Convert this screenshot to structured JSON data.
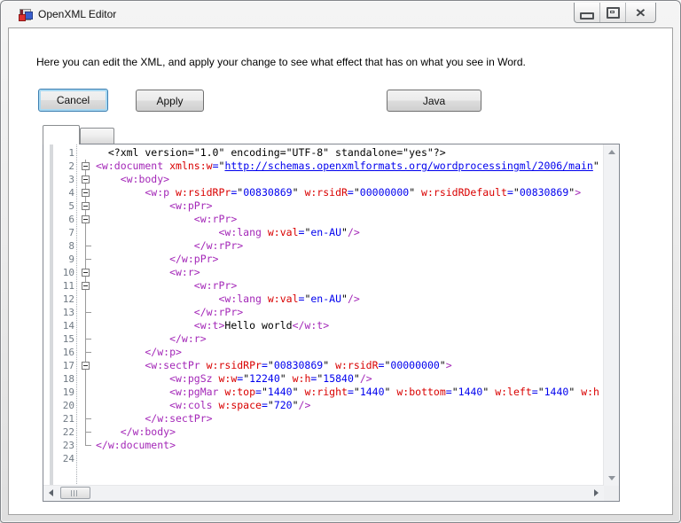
{
  "window": {
    "title": "OpenXML Editor",
    "controls": {
      "minimize_icon": "minimize",
      "maximize_icon": "maximize",
      "close_icon": "✕"
    }
  },
  "instructions": "Here you can edit the XML, and apply your change to see what effect that has on what you see in Word.",
  "buttons": {
    "cancel": "Cancel",
    "apply": "Apply",
    "java": "Java"
  },
  "tabs": [
    {
      "label": ""
    },
    {
      "label": ""
    }
  ],
  "colors": {
    "syntax": {
      "tag": "#A428B8",
      "attr": "#D90000",
      "value": "#0000EE",
      "equals": "#0000EE",
      "quote": "#000000",
      "text": "#000000",
      "link": "#0000EE"
    },
    "focus_accent": "#3C7FB1",
    "line_number": "#707A84"
  },
  "editor": {
    "lines": [
      {
        "num": 1,
        "fold": "none",
        "tokens": [
          [
            "x",
            "  <?xml version=\"1.0\" encoding=\"UTF-8\" standalone=\"yes\"?>"
          ]
        ]
      },
      {
        "num": 2,
        "fold": "box",
        "tokens": [
          [
            "t",
            "<w:document "
          ],
          [
            "a",
            "xmlns:w"
          ],
          [
            "e",
            "="
          ],
          [
            "q",
            "\""
          ],
          [
            "u",
            "http://schemas.openxmlformats.org/wordprocessingml/2006/main"
          ],
          [
            "q",
            "\""
          ]
        ]
      },
      {
        "num": 3,
        "fold": "box",
        "tokens": [
          [
            "t",
            "    <w:body>"
          ]
        ]
      },
      {
        "num": 4,
        "fold": "box",
        "tokens": [
          [
            "t",
            "        <w:p "
          ],
          [
            "a",
            "w:rsidRPr"
          ],
          [
            "e",
            "="
          ],
          [
            "q",
            "\""
          ],
          [
            "v",
            "00830869"
          ],
          [
            "q",
            "\" "
          ],
          [
            "a",
            "w:rsidR"
          ],
          [
            "e",
            "="
          ],
          [
            "q",
            "\""
          ],
          [
            "v",
            "00000000"
          ],
          [
            "q",
            "\" "
          ],
          [
            "a",
            "w:rsidRDefault"
          ],
          [
            "e",
            "="
          ],
          [
            "q",
            "\""
          ],
          [
            "v",
            "00830869"
          ],
          [
            "q",
            "\""
          ],
          [
            "t",
            ">"
          ]
        ]
      },
      {
        "num": 5,
        "fold": "box",
        "tokens": [
          [
            "t",
            "            <w:pPr>"
          ]
        ]
      },
      {
        "num": 6,
        "fold": "box",
        "tokens": [
          [
            "t",
            "                <w:rPr>"
          ]
        ]
      },
      {
        "num": 7,
        "fold": "line",
        "tokens": [
          [
            "t",
            "                    <w:lang "
          ],
          [
            "a",
            "w:val"
          ],
          [
            "e",
            "="
          ],
          [
            "q",
            "\""
          ],
          [
            "v",
            "en-AU"
          ],
          [
            "q",
            "\""
          ],
          [
            "t",
            "/>"
          ]
        ]
      },
      {
        "num": 8,
        "fold": "tick",
        "tokens": [
          [
            "t",
            "                </w:rPr>"
          ]
        ]
      },
      {
        "num": 9,
        "fold": "tick",
        "tokens": [
          [
            "t",
            "            </w:pPr>"
          ]
        ]
      },
      {
        "num": 10,
        "fold": "box",
        "tokens": [
          [
            "t",
            "            <w:r>"
          ]
        ]
      },
      {
        "num": 11,
        "fold": "box",
        "tokens": [
          [
            "t",
            "                <w:rPr>"
          ]
        ]
      },
      {
        "num": 12,
        "fold": "line",
        "tokens": [
          [
            "t",
            "                    <w:lang "
          ],
          [
            "a",
            "w:val"
          ],
          [
            "e",
            "="
          ],
          [
            "q",
            "\""
          ],
          [
            "v",
            "en-AU"
          ],
          [
            "q",
            "\""
          ],
          [
            "t",
            "/>"
          ]
        ]
      },
      {
        "num": 13,
        "fold": "tick",
        "tokens": [
          [
            "t",
            "                </w:rPr>"
          ]
        ]
      },
      {
        "num": 14,
        "fold": "line",
        "tokens": [
          [
            "t",
            "                <w:t>"
          ],
          [
            "x",
            "Hello world"
          ],
          [
            "t",
            "</w:t>"
          ]
        ]
      },
      {
        "num": 15,
        "fold": "tick",
        "tokens": [
          [
            "t",
            "            </w:r>"
          ]
        ]
      },
      {
        "num": 16,
        "fold": "tick",
        "tokens": [
          [
            "t",
            "        </w:p>"
          ]
        ]
      },
      {
        "num": 17,
        "fold": "box",
        "tokens": [
          [
            "t",
            "        <w:sectPr "
          ],
          [
            "a",
            "w:rsidRPr"
          ],
          [
            "e",
            "="
          ],
          [
            "q",
            "\""
          ],
          [
            "v",
            "00830869"
          ],
          [
            "q",
            "\" "
          ],
          [
            "a",
            "w:rsidR"
          ],
          [
            "e",
            "="
          ],
          [
            "q",
            "\""
          ],
          [
            "v",
            "00000000"
          ],
          [
            "q",
            "\""
          ],
          [
            "t",
            ">"
          ]
        ]
      },
      {
        "num": 18,
        "fold": "line",
        "tokens": [
          [
            "t",
            "            <w:pgSz "
          ],
          [
            "a",
            "w:w"
          ],
          [
            "e",
            "="
          ],
          [
            "q",
            "\""
          ],
          [
            "v",
            "12240"
          ],
          [
            "q",
            "\" "
          ],
          [
            "a",
            "w:h"
          ],
          [
            "e",
            "="
          ],
          [
            "q",
            "\""
          ],
          [
            "v",
            "15840"
          ],
          [
            "q",
            "\""
          ],
          [
            "t",
            "/>"
          ]
        ]
      },
      {
        "num": 19,
        "fold": "line",
        "tokens": [
          [
            "t",
            "            <w:pgMar "
          ],
          [
            "a",
            "w:top"
          ],
          [
            "e",
            "="
          ],
          [
            "q",
            "\""
          ],
          [
            "v",
            "1440"
          ],
          [
            "q",
            "\" "
          ],
          [
            "a",
            "w:right"
          ],
          [
            "e",
            "="
          ],
          [
            "q",
            "\""
          ],
          [
            "v",
            "1440"
          ],
          [
            "q",
            "\" "
          ],
          [
            "a",
            "w:bottom"
          ],
          [
            "e",
            "="
          ],
          [
            "q",
            "\""
          ],
          [
            "v",
            "1440"
          ],
          [
            "q",
            "\" "
          ],
          [
            "a",
            "w:left"
          ],
          [
            "e",
            "="
          ],
          [
            "q",
            "\""
          ],
          [
            "v",
            "1440"
          ],
          [
            "q",
            "\" "
          ],
          [
            "a",
            "w:h"
          ]
        ]
      },
      {
        "num": 20,
        "fold": "line",
        "tokens": [
          [
            "t",
            "            <w:cols "
          ],
          [
            "a",
            "w:space"
          ],
          [
            "e",
            "="
          ],
          [
            "q",
            "\""
          ],
          [
            "v",
            "720"
          ],
          [
            "q",
            "\""
          ],
          [
            "t",
            "/>"
          ]
        ]
      },
      {
        "num": 21,
        "fold": "tick",
        "tokens": [
          [
            "t",
            "        </w:sectPr>"
          ]
        ]
      },
      {
        "num": 22,
        "fold": "tick",
        "tokens": [
          [
            "t",
            "    </w:body>"
          ]
        ]
      },
      {
        "num": 23,
        "fold": "end",
        "tokens": [
          [
            "t",
            "</w:document>"
          ]
        ]
      },
      {
        "num": 24,
        "fold": "none",
        "tokens": []
      }
    ]
  }
}
